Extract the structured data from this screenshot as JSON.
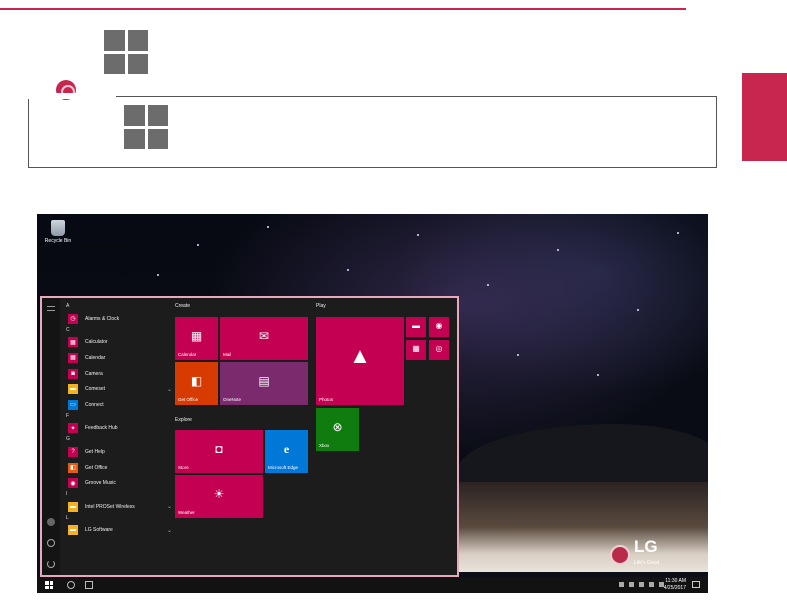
{
  "colors": {
    "accent": "#c8264f",
    "tile_magenta": "#c30052",
    "tile_orange": "#d83b01",
    "tile_purple": "#7b2a6e",
    "tile_blue": "#0078d7",
    "tile_green": "#107c10"
  },
  "desktop": {
    "recycle_bin_label": "Recycle Bin",
    "lg_logo": {
      "brand": "LG",
      "tagline": "Life's Good"
    }
  },
  "start_menu": {
    "app_list": [
      {
        "type": "header",
        "label": "A"
      },
      {
        "type": "app",
        "label": "Alarms & Clock",
        "icon": "alarm-icon",
        "color": "magenta"
      },
      {
        "type": "header",
        "label": "C"
      },
      {
        "type": "app",
        "label": "Calculator",
        "icon": "calculator-icon",
        "color": "magenta"
      },
      {
        "type": "app",
        "label": "Calendar",
        "icon": "calendar-icon",
        "color": "magenta"
      },
      {
        "type": "app",
        "label": "Camera",
        "icon": "camera-icon",
        "color": "magenta"
      },
      {
        "type": "app",
        "label": "Comeset",
        "icon": "folder-icon",
        "color": "yellow",
        "expandable": true
      },
      {
        "type": "app",
        "label": "Connect",
        "icon": "connect-icon",
        "color": "blue"
      },
      {
        "type": "header",
        "label": "F"
      },
      {
        "type": "app",
        "label": "Feedback Hub",
        "icon": "feedback-icon",
        "color": "magenta"
      },
      {
        "type": "header",
        "label": "G"
      },
      {
        "type": "app",
        "label": "Get Help",
        "icon": "help-icon",
        "color": "magenta"
      },
      {
        "type": "app",
        "label": "Get Office",
        "icon": "office-icon",
        "color": "orange"
      },
      {
        "type": "app",
        "label": "Groove Music",
        "icon": "music-icon",
        "color": "magenta"
      },
      {
        "type": "header",
        "label": "I"
      },
      {
        "type": "app",
        "label": "Intel PROSet Wireless",
        "icon": "folder-icon",
        "color": "yellow",
        "expandable": true
      },
      {
        "type": "header",
        "label": "L"
      },
      {
        "type": "app",
        "label": "LG Software",
        "icon": "folder-icon",
        "color": "yellow",
        "expandable": true
      }
    ],
    "groups": {
      "create": "Create",
      "play": "Play",
      "explore": "Explore"
    },
    "tiles": {
      "calendar": "Calendar",
      "mail": "Mail",
      "get_office": "Get Office",
      "onenote": "OneNote",
      "photos": "Photos",
      "xbox": "Xbox",
      "store": "Store",
      "microsoft_edge": "Microsoft Edge",
      "weather": "Weather"
    }
  },
  "taskbar": {
    "time": "11:30 AM",
    "date": "4/25/2017"
  }
}
